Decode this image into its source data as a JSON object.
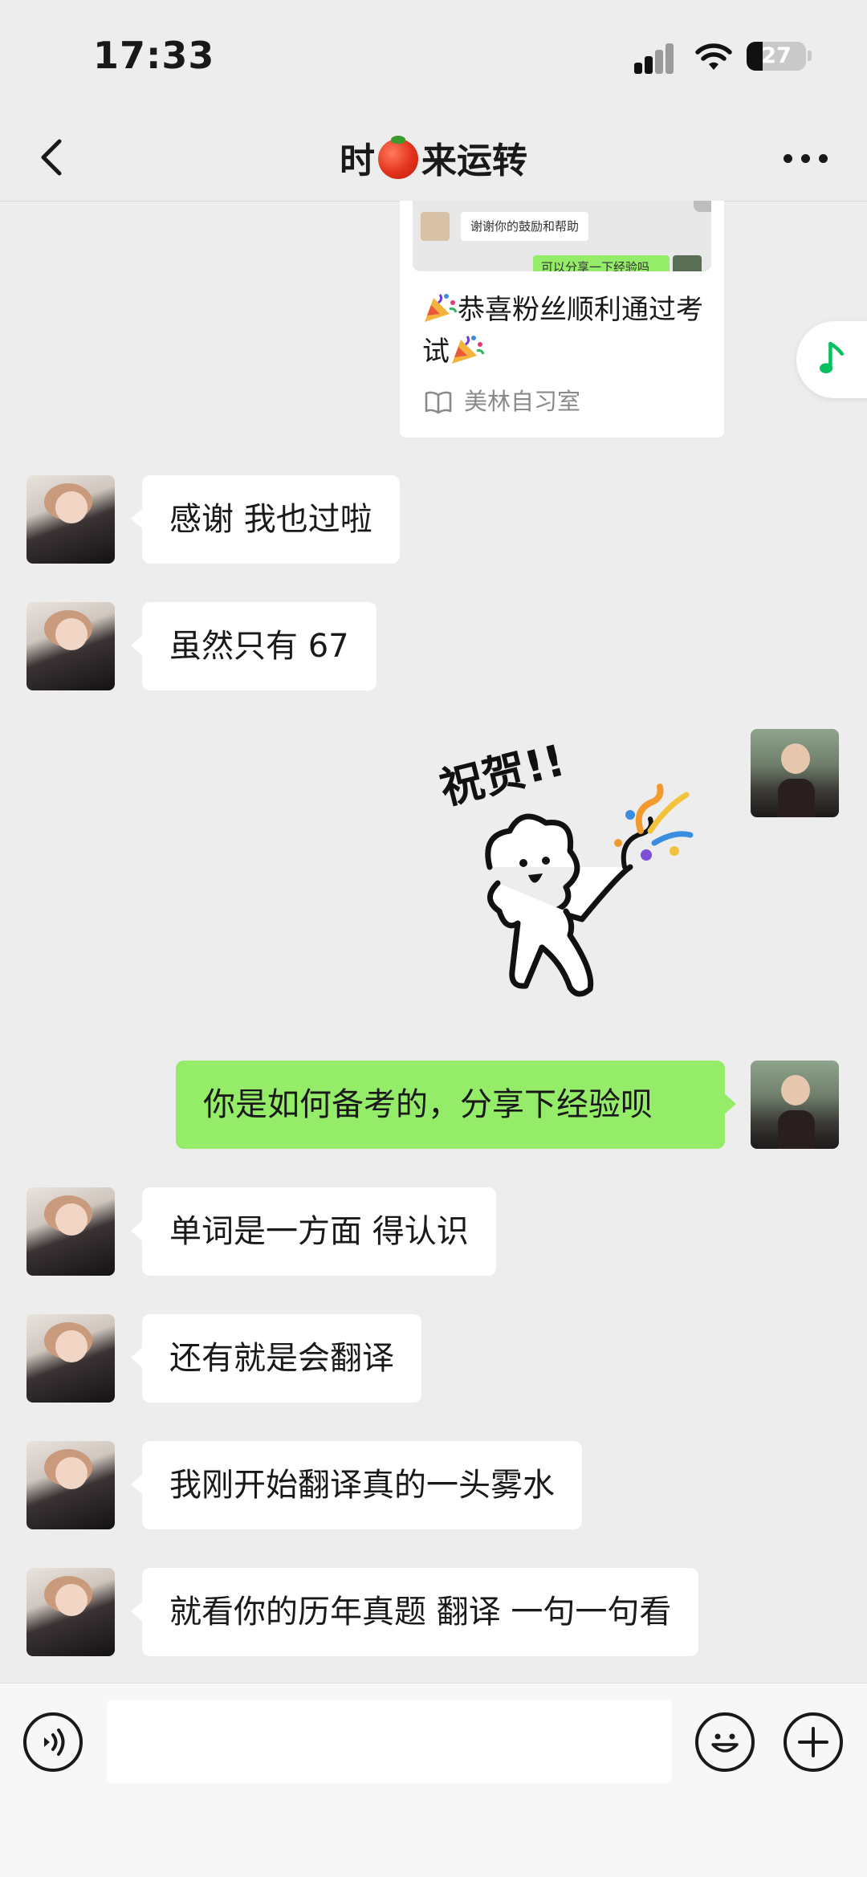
{
  "status_bar": {
    "time": "17:33",
    "battery": "27",
    "battery_level": 0.27
  },
  "nav": {
    "title_before": "时",
    "title_after": "来运转",
    "title_icon": "tomato-emoji"
  },
  "shared_card": {
    "preview_text": "谢谢你的鼓励和帮助",
    "preview_green_text": "可以分享一下经验吗",
    "title": "恭喜粉丝顺利通过考试",
    "title_icon": "party-popper-emoji",
    "source": "美林自习室",
    "source_icon": "book-icon"
  },
  "messages": [
    {
      "side": "left",
      "text": "感谢   我也过啦"
    },
    {
      "side": "left",
      "text": "虽然只有 67"
    },
    {
      "side": "right",
      "type": "sticker",
      "sticker_text": "祝贺!!"
    },
    {
      "side": "right",
      "text": "你是如何备考的，分享下经验呗"
    },
    {
      "side": "left",
      "text": "单词是一方面  得认识"
    },
    {
      "side": "left",
      "text": "还有就是会翻译"
    },
    {
      "side": "left",
      "text": "我刚开始翻译真的一头雾水"
    },
    {
      "side": "left",
      "text": "就看你的历年真题 翻译 一句一句看"
    }
  ],
  "input": {
    "value": "",
    "placeholder": ""
  },
  "colors": {
    "background": "#ededed",
    "my_bubble": "#95ec69",
    "their_bubble": "#ffffff",
    "accent_green": "#07c160"
  }
}
